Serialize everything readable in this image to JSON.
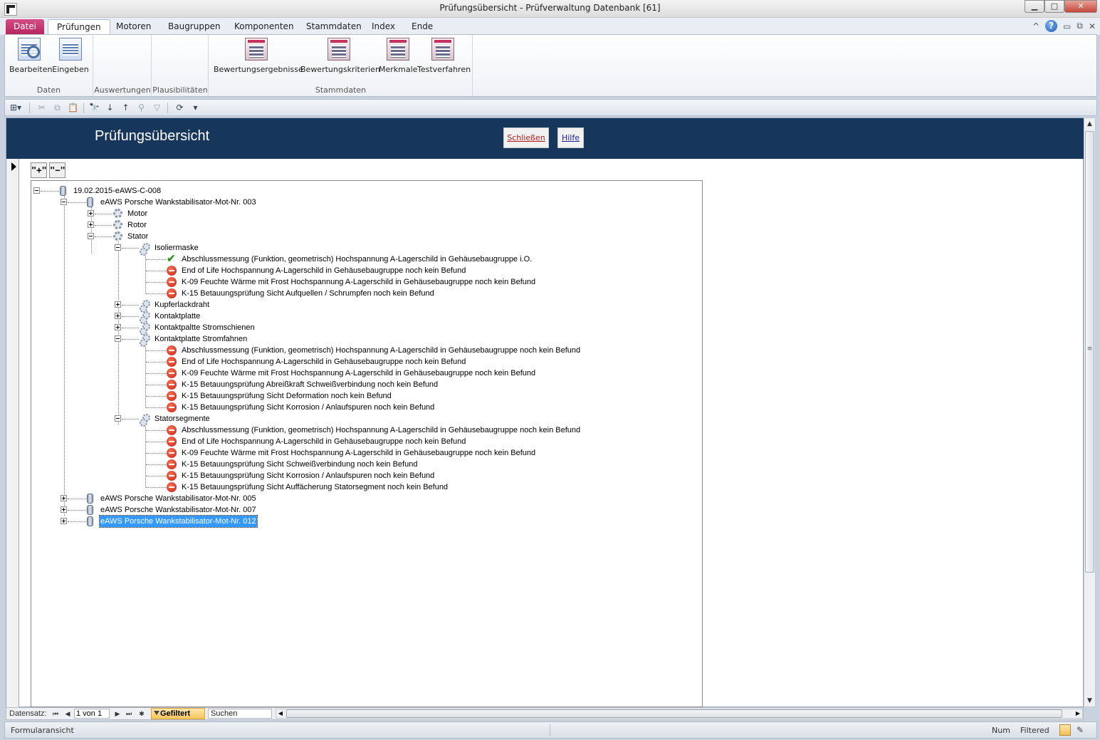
{
  "window": {
    "title": "Prüfungsübersicht  -  Prüfverwaltung Datenbank [61]",
    "minimize": "▁",
    "maximize": "□",
    "close": "✕"
  },
  "ribbon": {
    "tabs": [
      "Datei",
      "Prüfungen",
      "Motoren",
      "Baugruppen",
      "Komponenten",
      "Stammdaten",
      "Index",
      "Ende"
    ],
    "right_controls": {
      "collapse": "^",
      "help": "?",
      "min": "▭",
      "restore": "⧉",
      "close": "✕"
    },
    "groups": {
      "daten": {
        "label": "Daten",
        "buttons": [
          "Bearbeiten",
          "Eingeben"
        ]
      },
      "auswertungen": {
        "label": "Auswertungen"
      },
      "plausibilitaeten": {
        "label": "Plausibilitäten"
      },
      "stammdaten": {
        "label": "Stammdaten",
        "buttons": [
          "Bewertungsergebnisse",
          "Bewertungskriterien",
          "Merkmale",
          "Testverfahren"
        ]
      }
    }
  },
  "form": {
    "title": "Prüfungsübersicht",
    "close_button": "Schließen",
    "help_button": "Hilfe",
    "expand_all": "\"+\"",
    "collapse_all": "\"−\""
  },
  "tree": {
    "root": "19.02.2015-eAWS-C-008",
    "motor_003": "eAWS Porsche Wankstabilisator-Mot-Nr. 003",
    "motor": "Motor",
    "rotor": "Rotor",
    "stator": "Stator",
    "isoliermaske": "Isoliermaske",
    "iso_items": [
      "Abschlussmessung (Funktion, geometrisch) Hochspannung A-Lagerschild in Gehäusebaugruppe i.O.",
      "End of Life Hochspannung A-Lagerschild in Gehäusebaugruppe noch kein Befund",
      "K-09 Feuchte Wärme mit Frost Hochspannung A-Lagerschild in Gehäusebaugruppe noch kein Befund",
      "K-15 Betauungsprüfung Sicht Aufquellen / Schrumpfen noch kein Befund"
    ],
    "kupferlackdraht": "Kupferlackdraht",
    "kontaktplatte": "Kontaktplatte",
    "kontaktpaltte_stromschienen": "Kontaktpaltte Stromschienen",
    "kontaktplatte_stromfahnen": "Kontaktplatte Stromfahnen",
    "stromfahnen_items": [
      "Abschlussmessung (Funktion, geometrisch) Hochspannung A-Lagerschild in Gehäusebaugruppe noch kein Befund",
      "End of Life Hochspannung A-Lagerschild in Gehäusebaugruppe noch kein Befund",
      "K-09 Feuchte Wärme mit Frost Hochspannung A-Lagerschild in Gehäusebaugruppe noch kein Befund",
      "K-15 Betauungsprüfung Abreißkraft Schweißverbindung noch kein Befund",
      "K-15 Betauungsprüfung Sicht Deformation noch kein Befund",
      "K-15 Betauungsprüfung Sicht Korrosion / Anlaufspuren noch kein Befund"
    ],
    "statorsegmente": "Statorsegmente",
    "segment_items": [
      "Abschlussmessung (Funktion, geometrisch) Hochspannung A-Lagerschild in Gehäusebaugruppe noch kein Befund",
      "End of Life Hochspannung A-Lagerschild in Gehäusebaugruppe noch kein Befund",
      "K-09 Feuchte Wärme mit Frost Hochspannung A-Lagerschild in Gehäusebaugruppe noch kein Befund",
      "K-15 Betauungsprüfung Sicht Schweißverbindung noch kein Befund",
      "K-15 Betauungsprüfung Sicht Korrosion / Anlaufspuren noch kein Befund",
      "K-15 Betauungsprüfung Sicht Auffächerung Statorsegment noch kein Befund"
    ],
    "motor_005": "eAWS Porsche Wankstabilisator-Mot-Nr. 005",
    "motor_007": "eAWS Porsche Wankstabilisator-Mot-Nr. 007",
    "motor_012": "eAWS Porsche Wankstabilisator-Mot-Nr. 012"
  },
  "navigation": {
    "label": "Datensatz:",
    "record": "1 von 1",
    "filter": "Gefiltert",
    "search": "Suchen",
    "first": "⏮",
    "prev": "◀",
    "next": "▶",
    "last": "⏭",
    "new": "✱"
  },
  "status": {
    "left": "Formularansicht",
    "num": "Num",
    "filtered": "Filtered"
  }
}
